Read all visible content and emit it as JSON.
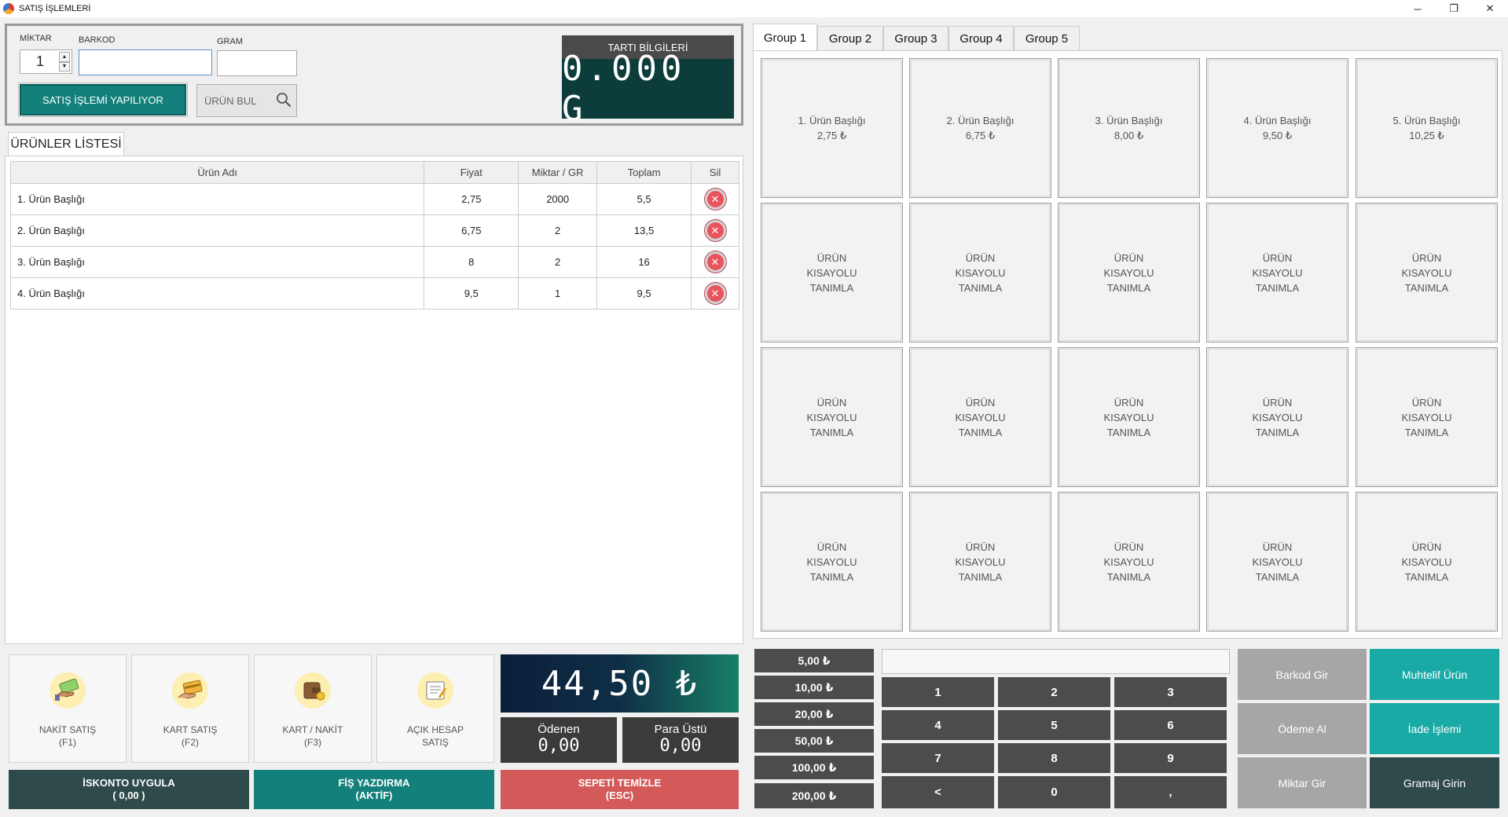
{
  "window": {
    "title": "SATIŞ İŞLEMLERİ",
    "minimize": "─",
    "restore": "❐",
    "close": "✕"
  },
  "entry": {
    "miktar_label": "MİKTAR",
    "miktar_value": "1",
    "barkod_label": "BARKOD",
    "barkod_value": "",
    "gram_label": "GRAM",
    "gram_value": "",
    "sales_button": "SATIŞ İŞLEMİ YAPILIYOR",
    "find_button": "ÜRÜN BUL"
  },
  "scale": {
    "title": "TARTI BİLGİLERİ",
    "reading": "0.000 G"
  },
  "products": {
    "tab": "ÜRÜNLER LİSTESİ",
    "columns": [
      "Ürün Adı",
      "Fiyat",
      "Miktar / GR",
      "Toplam",
      "Sil"
    ],
    "rows": [
      {
        "name": "1. Ürün Başlığı",
        "price": "2,75",
        "qty": "2000",
        "total": "5,5"
      },
      {
        "name": "2. Ürün Başlığı",
        "price": "6,75",
        "qty": "2",
        "total": "13,5"
      },
      {
        "name": "3. Ürün Başlığı",
        "price": "8",
        "qty": "2",
        "total": "16"
      },
      {
        "name": "4. Ürün Başlığı",
        "price": "9,5",
        "qty": "1",
        "total": "9,5"
      }
    ]
  },
  "payment": {
    "tiles": [
      {
        "line1": "NAKİT SATIŞ",
        "line2": "(F1)",
        "icon": "cash-icon"
      },
      {
        "line1": "KART SATIŞ",
        "line2": "(F2)",
        "icon": "card-icon"
      },
      {
        "line1": "KART / NAKİT",
        "line2": "(F3)",
        "icon": "wallet-icon"
      },
      {
        "line1": "AÇIK HESAP",
        "line2": "SATIŞ",
        "icon": "ledger-icon"
      }
    ],
    "total": "44,50 ₺",
    "paid_label": "Ödenen",
    "paid_value": "0,00",
    "change_label": "Para Üstü",
    "change_value": "0,00",
    "discount_line1": "İSKONTO UYGULA",
    "discount_line2": "( 0,00 )",
    "receipt_line1": "FİŞ YAZDIRMA",
    "receipt_line2": "(AKTİF)",
    "clear_line1": "SEPETİ TEMİZLE",
    "clear_line2": "(ESC)"
  },
  "groups": [
    "Group 1",
    "Group 2",
    "Group 3",
    "Group 4",
    "Group 5"
  ],
  "shortcuts": {
    "products": [
      {
        "name": "1. Ürün Başlığı",
        "price": "2,75 ₺"
      },
      {
        "name": "2. Ürün Başlığı",
        "price": "6,75 ₺"
      },
      {
        "name": "3. Ürün Başlığı",
        "price": "8,00 ₺"
      },
      {
        "name": "4. Ürün Başlığı",
        "price": "9,50 ₺"
      },
      {
        "name": "5. Ürün Başlığı",
        "price": "10,25 ₺"
      }
    ],
    "empty_line1": "ÜRÜN",
    "empty_line2": "KISAYOLU",
    "empty_line3": "TANIMLA"
  },
  "money_buttons": [
    "5,00 ₺",
    "10,00 ₺",
    "20,00 ₺",
    "50,00 ₺",
    "100,00 ₺",
    "200,00 ₺"
  ],
  "numpad": [
    "1",
    "2",
    "3",
    "4",
    "5",
    "6",
    "7",
    "8",
    "9",
    "<",
    "0",
    ","
  ],
  "function_buttons": {
    "barkod": "Barkod Gir",
    "muhtelif": "Muhtelif Ürün",
    "odeme": "Ödeme Al",
    "iade": "İade İşlemi",
    "miktar": "Miktar Gir",
    "gramaj": "Gramaj Girin"
  },
  "colors": {
    "teal": "#13807b",
    "dark_slate": "#2f4a4a",
    "gray_key": "#4c4c4c",
    "red": "#d45a5a",
    "bright_teal": "#1aaaa5"
  }
}
